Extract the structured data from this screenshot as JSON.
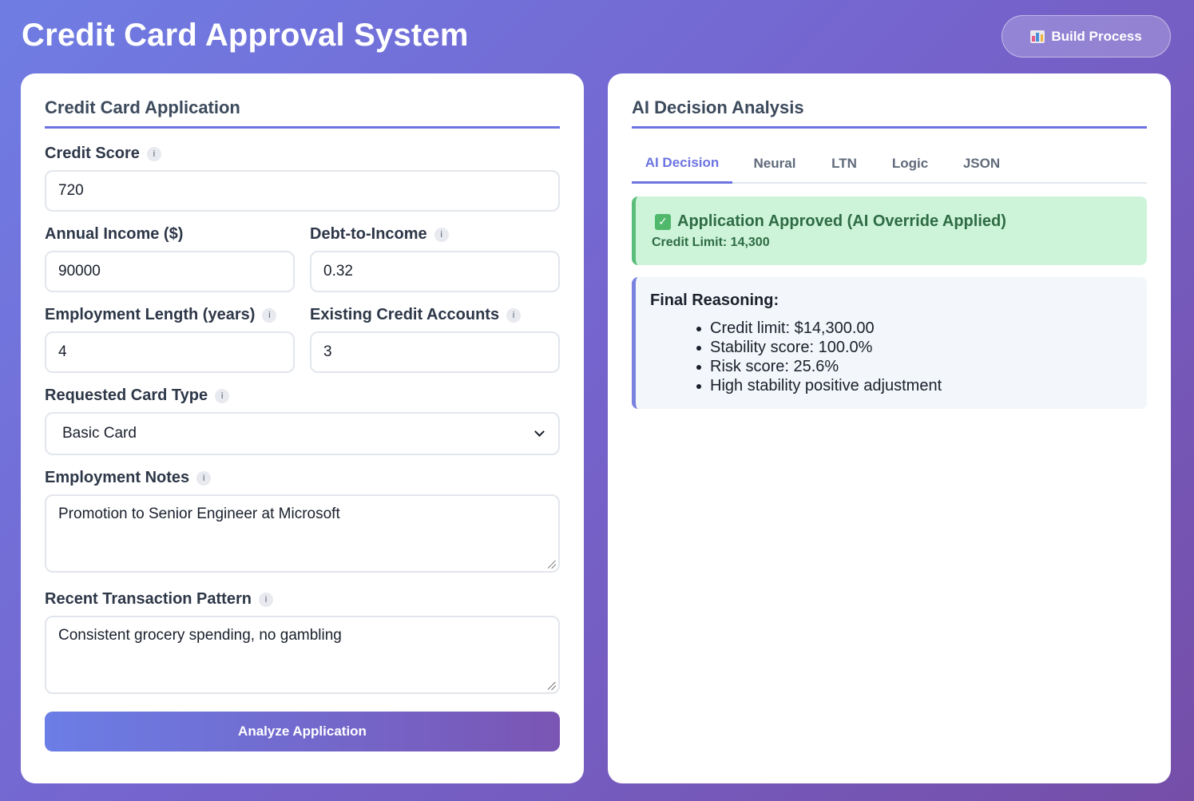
{
  "header": {
    "title": "Credit Card Approval System",
    "build_button_label": "Build Process",
    "build_button_icon": "bar-chart-icon"
  },
  "form": {
    "title": "Credit Card Application",
    "credit_score": {
      "label": "Credit Score",
      "value": "720"
    },
    "annual_income": {
      "label": "Annual Income ($)",
      "value": "90000"
    },
    "debt_to_income": {
      "label": "Debt-to-Income",
      "value": "0.32"
    },
    "employment_length": {
      "label": "Employment Length (years)",
      "value": "4"
    },
    "existing_accounts": {
      "label": "Existing Credit Accounts",
      "value": "3"
    },
    "card_type": {
      "label": "Requested Card Type",
      "value": "Basic Card"
    },
    "employment_notes": {
      "label": "Employment Notes",
      "value": "Promotion to Senior Engineer at Microsoft"
    },
    "transaction_pattern": {
      "label": "Recent Transaction Pattern",
      "value": "Consistent grocery spending, no gambling"
    },
    "info_glyph": "i",
    "submit_label": "Analyze Application"
  },
  "analysis": {
    "title": "AI Decision Analysis",
    "tabs": [
      {
        "label": "AI Decision",
        "active": true
      },
      {
        "label": "Neural",
        "active": false
      },
      {
        "label": "LTN",
        "active": false
      },
      {
        "label": "Logic",
        "active": false
      },
      {
        "label": "JSON",
        "active": false
      }
    ],
    "result": {
      "title": "Application Approved (AI Override Applied)",
      "subtitle": "Credit Limit: 14,300",
      "icon": "check-icon"
    },
    "reasoning": {
      "title": "Final Reasoning:",
      "items": [
        "Credit limit: $14,300.00",
        "Stability score: 100.0%",
        "Risk score: 25.6%",
        "High stability positive adjustment"
      ]
    }
  },
  "colors": {
    "accent": "#6c74e0",
    "success_bg": "#cdf4d8",
    "success_text": "#2e6b44",
    "gradient_start": "#6f7de3",
    "gradient_end": "#754ea8"
  }
}
